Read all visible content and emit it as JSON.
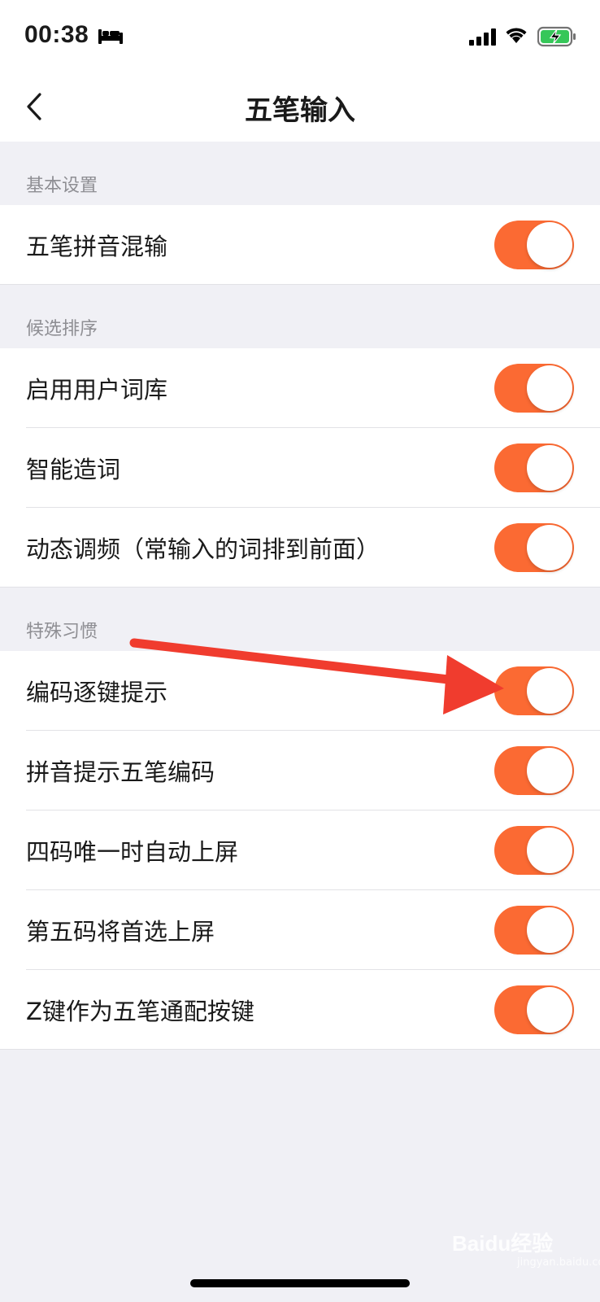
{
  "status_bar": {
    "time": "00:38",
    "icons": [
      "bed-icon",
      "signal-icon",
      "wifi-icon",
      "battery-charging-icon"
    ]
  },
  "nav": {
    "title": "五笔输入",
    "back_icon": "chevron-left-icon"
  },
  "sections": [
    {
      "header": "基本设置",
      "items": [
        {
          "label": "五笔拼音混输",
          "enabled": true
        }
      ]
    },
    {
      "header": "候选排序",
      "items": [
        {
          "label": "启用用户词库",
          "enabled": true
        },
        {
          "label": "智能造词",
          "enabled": true
        },
        {
          "label": "动态调频（常输入的词排到前面）",
          "enabled": true
        }
      ]
    },
    {
      "header": "特殊习惯",
      "items": [
        {
          "label": "编码逐键提示",
          "enabled": true
        },
        {
          "label": "拼音提示五笔编码",
          "enabled": true
        },
        {
          "label": "四码唯一时自动上屏",
          "enabled": true
        },
        {
          "label": "第五码将首选上屏",
          "enabled": true
        },
        {
          "label": "Z键作为五笔通配按键",
          "enabled": true
        }
      ]
    }
  ],
  "colors": {
    "toggle_on": "#fb6a33",
    "annotation_arrow": "#f03c2e",
    "background": "#f0f0f5"
  },
  "watermark": {
    "text": "Baidu经验",
    "sub": "jingyan.baidu.com"
  }
}
